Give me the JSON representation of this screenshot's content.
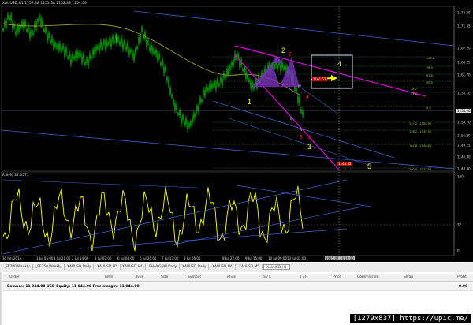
{
  "chart": {
    "symbol_label": "XAUUSD,H1  1152.38 1153.38 1152.38 1154.09",
    "rsi_label": "RSI(9) 37.3571",
    "price_ticks": [
      "1174.20",
      "1171.55",
      "1167.20",
      "1164.25",
      "1161.70",
      "1158.10",
      "1154.70",
      "1151.20",
      "1149.25",
      "1146.30",
      "1143.30"
    ],
    "current_price": "1154.00",
    "rsi_ticks": [
      "100",
      "37",
      "0"
    ],
    "time_ticks": [
      "30 Jun 2015",
      "1 Jul 05:00",
      "1 Jul 21:00",
      "2 Jul 14:00",
      "3 Jul 07:00",
      "6 Jul 04:00",
      "6 Jul 20:00",
      "7 Jul 13:00",
      "8 Jul 06:00",
      "8 Jul 22:00",
      "9 Jul 15:00",
      "10 Jul 09:00",
      "13 Jul 02:00"
    ],
    "time_cursor": "2015.07.14 16:00",
    "wave_labels_yellow": [
      "1",
      "2",
      "3",
      "4",
      "5"
    ],
    "wave_labels_red": [
      "2",
      "3",
      "4",
      "5"
    ],
    "roman_labels": [
      "III",
      "IV",
      "V"
    ],
    "red_tags": [
      "1161.52",
      "1143.82"
    ],
    "fib_labels": [
      "100.0",
      "76.4",
      "61.8",
      "50.0",
      "38.2",
      "23.6",
      "0.0",
      "127.2 - 1150.98",
      "138.2 - 1149.55",
      "161.8 - 1146.64",
      "200.0 - 1142.54"
    ]
  },
  "tabs": [
    "_SE700,Weekly",
    "_SE750,Weekly",
    "XAUUSD,Daily",
    "XAUUSD,H1",
    "XAUUSD,H4",
    "SHANGHAI,Daily",
    "XAUUSD,Daily",
    "XAUUSD,H4",
    "XAUUSD,M5",
    "XAUUSD,H1"
  ],
  "active_tab_index": 9,
  "terminal": {
    "columns": [
      "Order",
      "Time",
      "Type",
      "Size",
      "Symbol",
      "Price",
      "S / L",
      "T / P",
      "Price",
      "Commission",
      "Swap",
      "Profit"
    ],
    "balance_text": "Balance: 11 044.00 USD  Equity: 11 044.00  Free margin: 11 044.00",
    "balance_profit": "0.00"
  },
  "watermark": "[1279x837] https://upic.me/",
  "colors": {
    "candle": "#00dd00",
    "ma": "#9a9a2a",
    "rsi": "#ffff00",
    "trend_blue": "#4060d0",
    "channel_magenta": "#e000e0",
    "pattern_fill": "#7a30c0"
  }
}
